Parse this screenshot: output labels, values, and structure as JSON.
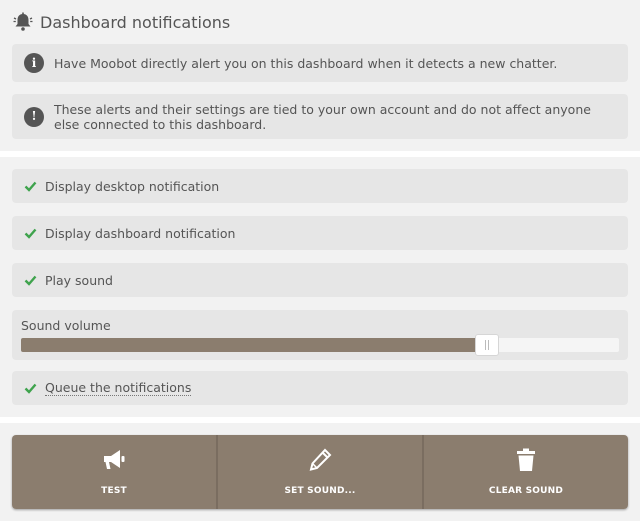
{
  "header": {
    "title": "Dashboard notifications",
    "icon": "bell-icon"
  },
  "info_messages": [
    {
      "icon": "info-icon",
      "text": "Have Moobot directly alert you on this dashboard when it detects a new chatter."
    },
    {
      "icon": "exclamation-icon",
      "text": "These alerts and their settings are tied to your own account and do not affect anyone else connected to this dashboard."
    }
  ],
  "settings": {
    "desktop_notification": {
      "label": "Display desktop notification",
      "checked": true
    },
    "dashboard_notification": {
      "label": "Display dashboard notification",
      "checked": true
    },
    "play_sound": {
      "label": "Play sound",
      "checked": true
    },
    "sound_volume": {
      "label": "Sound volume",
      "value_percent": 78
    },
    "queue_notifications": {
      "label": "Queue the notifications",
      "checked": true
    }
  },
  "buttons": {
    "test": {
      "label": "TEST",
      "icon": "megaphone-icon"
    },
    "set_sound": {
      "label": "SET SOUND...",
      "icon": "pencil-icon"
    },
    "clear_sound": {
      "label": "CLEAR SOUND",
      "icon": "trash-icon"
    }
  },
  "colors": {
    "accent": "#8b7d6e",
    "check": "#3fa34d"
  }
}
